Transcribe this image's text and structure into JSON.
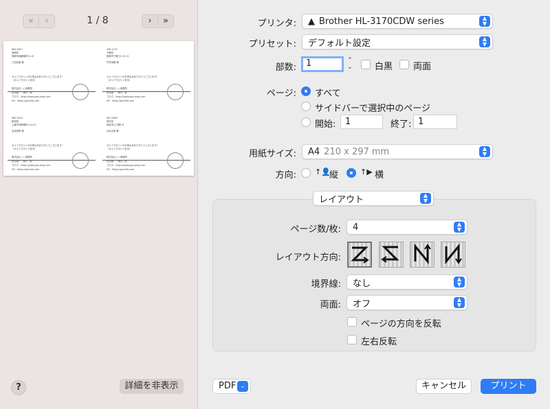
{
  "preview": {
    "page_indicator": "1 / 8",
    "first_icon": "«",
    "prev_icon": "‹",
    "next_icon": "›",
    "last_icon": "»",
    "help_label": "?",
    "hide_details_label": "詳細を非表示",
    "labels": [
      {
        "zip": "880-0817",
        "pref": "宮崎県",
        "addr": "宮崎市地蔵南町3-4-8",
        "name": "三宅紀雪 様"
      },
      {
        "zip": "299-1122",
        "pref": "千葉県",
        "addr": "君津市下湯江2-19-22",
        "name": "竹村栄健 様"
      },
      {
        "zip": "962-0254",
        "pref": "新潟県",
        "addr": "上越市清陽東町1-16-21",
        "name": "吉池亮昇 様"
      },
      {
        "zip": "067-0005",
        "pref": "埼玉県",
        "addr": "熊谷市えび堀2-8",
        "name": "元木正恵 様"
      }
    ],
    "label_message": "セルフマガジンのお申込みありがとうございます！",
    "label_sub": "（セルフマガジン在中）",
    "label_company": "株式会社 ○○事務所",
    "label_person": "担当者：　鍋川　慶",
    "label_blog": "ブログ：https://www.gou-blog.com",
    "label_hp": "HP：https://gouinfo.com",
    "stamp_text": "料金別納 郵便"
  },
  "printer": {
    "label": "プリンタ:",
    "value": "Brother HL-3170CDW series",
    "warning_icon": "▲"
  },
  "preset": {
    "label": "プリセット:",
    "value": "デフォルト設定"
  },
  "copies": {
    "label": "部数:",
    "value": "1",
    "bw_label": "白黒",
    "duplex_label": "両面"
  },
  "pages": {
    "label": "ページ:",
    "all_label": "すべて",
    "sidebar_label": "サイドバーで選択中のページ",
    "from_label": "開始:",
    "from_value": "1",
    "to_label": "終了:",
    "to_value": "1"
  },
  "paper": {
    "label": "用紙サイズ:",
    "value": "A4",
    "dims": "210 x 297 mm"
  },
  "orientation": {
    "label": "方向:",
    "portrait": "縦",
    "landscape": "横",
    "portrait_icon": "↑👤",
    "landscape_icon": "↑▶"
  },
  "section": {
    "value": "レイアウト"
  },
  "layout": {
    "pages_per_sheet_label": "ページ数/枚:",
    "pages_per_sheet_value": "4",
    "direction_label": "レイアウト方向:",
    "directions": [
      "Z",
      "S",
      "N",
      "И"
    ],
    "border_label": "境界線:",
    "border_value": "なし",
    "two_sided_label": "両面:",
    "two_sided_value": "オフ",
    "reverse_label": "ページの方向を反転",
    "flip_label": "左右反転"
  },
  "footer": {
    "pdf_label": "PDF",
    "cancel_label": "キャンセル",
    "print_label": "プリント"
  },
  "colors": {
    "accent": "#2f7cf6",
    "sidebar_bg": "#ebe4e3",
    "panel_bg": "#ececec"
  }
}
